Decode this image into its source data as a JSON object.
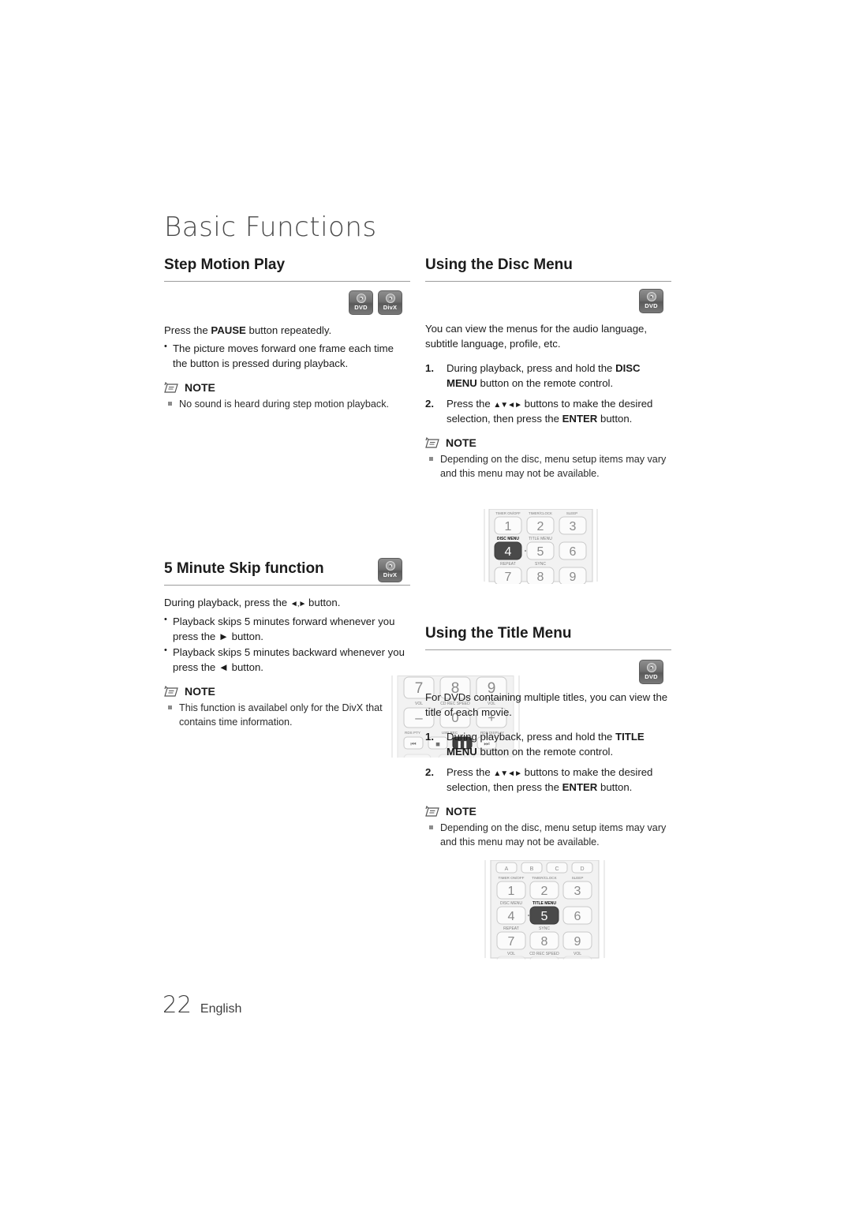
{
  "page": {
    "title": "Basic Functions",
    "footer_page_number": "22",
    "footer_language": "English"
  },
  "note_label": "NOTE",
  "badges": {
    "dvd": "DVD",
    "divx": "DivX"
  },
  "sections": {
    "step_motion": {
      "heading": "Step Motion Play",
      "intro_prefix": "Press the ",
      "intro_bold": "PAUSE",
      "intro_suffix": " button repeatedly.",
      "bullets": [
        "The picture moves forward one frame each time the button is pressed during playback."
      ],
      "notes": [
        "No sound is heard during step motion playback."
      ]
    },
    "skip5": {
      "heading": "5 Minute Skip function",
      "intro_prefix": "During playback, press the ",
      "intro_arrows": "◄,►",
      "intro_suffix": " button.",
      "bullets": [
        "Playback skips 5 minutes forward whenever you press the ► button.",
        "Playback skips 5 minutes backward whenever you press the ◄ button."
      ],
      "notes": [
        "This function is availabel only for the DivX that contains time information."
      ]
    },
    "disc_menu": {
      "heading": "Using the Disc Menu",
      "intro": "You can view the menus for the audio language, subtitle language, profile, etc.",
      "steps": [
        {
          "num": "1.",
          "text_1": "During playback, press  and hold the ",
          "bold_1": "DISC MENU",
          "text_2": " button on the remote control."
        },
        {
          "num": "2.",
          "text_1": "Press the ",
          "arrows": "▲▼◄►",
          "text_2": " buttons to make the desired selection, then press the ",
          "bold_1": "ENTER",
          "text_3": " button."
        }
      ],
      "notes": [
        "Depending on the disc, menu setup items may vary and this menu may not be available."
      ]
    },
    "title_menu": {
      "heading": "Using the Title Menu",
      "intro": "For DVDs containing multiple titles, you can view the title of each movie.",
      "steps": [
        {
          "num": "1.",
          "text_1": "During playback, press  and hold the ",
          "bold_1": "TITLE MENU",
          "text_2": " button on the remote control."
        },
        {
          "num": "2.",
          "text_1": "Press the ",
          "arrows": "▲▼◄►",
          "text_2": " buttons to make the desired selection, then press the ",
          "bold_1": "ENTER",
          "text_3": " button."
        }
      ],
      "notes": [
        "Depending on the disc, menu setup items may vary and this menu may not be available."
      ]
    }
  },
  "remote_step_motion": {
    "row_keys": [
      "7",
      "8",
      "9"
    ],
    "labels_row1": [
      "VOL",
      "CD REC SPEED",
      "VOL"
    ],
    "row_keys2": [
      "–",
      "0",
      "+"
    ],
    "labels_row2": [
      "RDS PTY",
      "USB REC",
      "RDS DISPLAY"
    ],
    "transport": [
      "⏮",
      "■",
      "⏸",
      "⏭"
    ],
    "highlight": "pause"
  },
  "remote_disc_menu": {
    "labels_top": [
      "TIMER ON/OFF",
      "TIMER/CLOCK",
      "SLEEP"
    ],
    "keys_row1": [
      "1",
      "2",
      "3"
    ],
    "labels_mid": [
      "DISC MENU",
      "TITLE MENU"
    ],
    "keys_row2": [
      "4",
      "5",
      "6"
    ],
    "labels_bottom": [
      "REPEAT",
      "SYNC"
    ],
    "keys_row3": [
      "7",
      "8",
      "9"
    ],
    "highlight": "4"
  },
  "remote_title_menu": {
    "keys_abcd": [
      "A",
      "B",
      "C",
      "D"
    ],
    "labels_top": [
      "TIMER ON/OFF",
      "TIMER/CLOCK",
      "SLEEP"
    ],
    "keys_row1": [
      "1",
      "2",
      "3"
    ],
    "labels_mid": [
      "DISC MENU",
      "TITLE MENU"
    ],
    "keys_row2": [
      "4",
      "5",
      "6"
    ],
    "labels_bottom": [
      "REPEAT",
      "SYNC"
    ],
    "keys_row3": [
      "7",
      "8",
      "9"
    ],
    "labels_bottom2": [
      "VOL",
      "CD REC SPEED",
      "VOL"
    ],
    "highlight": "5"
  }
}
